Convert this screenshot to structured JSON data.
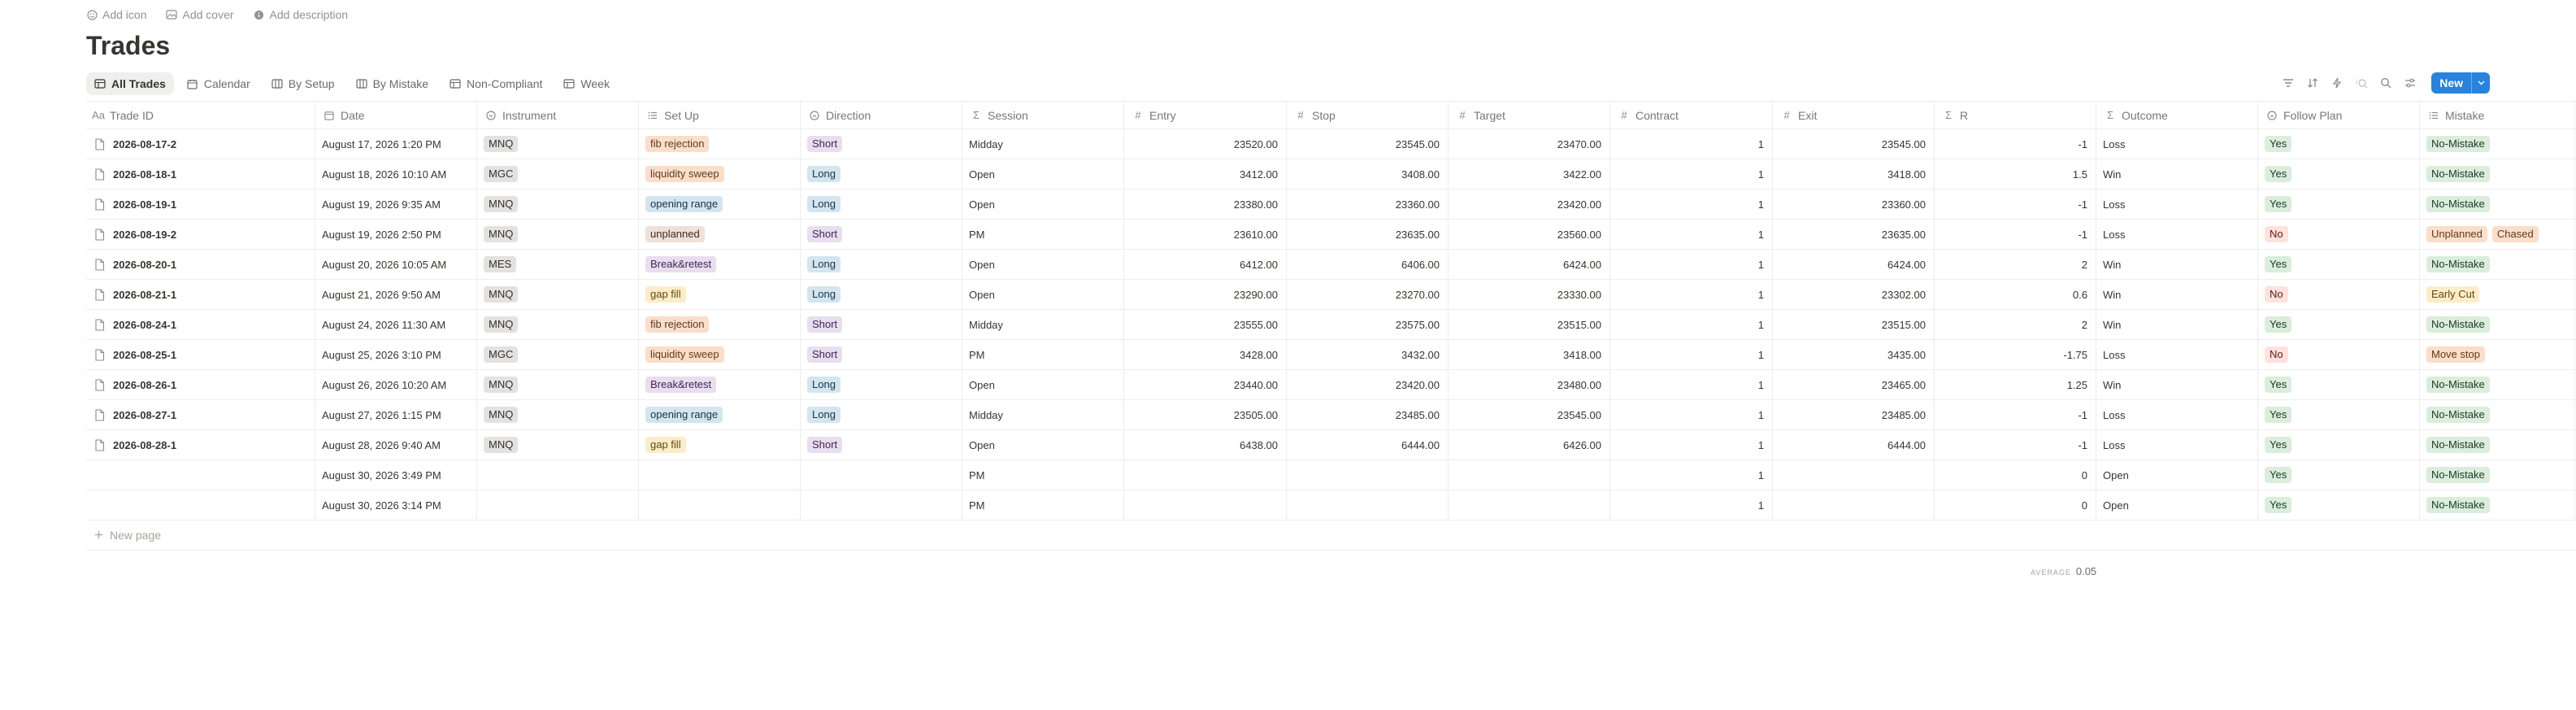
{
  "top_links": [
    {
      "label": "Add icon",
      "icon": "emoji-icon"
    },
    {
      "label": "Add cover",
      "icon": "image-icon"
    },
    {
      "label": "Add description",
      "icon": "info-icon"
    }
  ],
  "page_title": "Trades",
  "tabs": [
    {
      "label": "All Trades",
      "icon": "table-icon",
      "active": true
    },
    {
      "label": "Calendar",
      "icon": "calendar-icon"
    },
    {
      "label": "By Setup",
      "icon": "board-icon"
    },
    {
      "label": "By Mistake",
      "icon": "board-icon"
    },
    {
      "label": "Non-Compliant",
      "icon": "table-icon"
    },
    {
      "label": "Week",
      "icon": "table-icon"
    }
  ],
  "toolbar": {
    "new_label": "New",
    "accent": "#2783de"
  },
  "columns": [
    {
      "label": "Trade ID",
      "icon": "Aa"
    },
    {
      "label": "Date",
      "icon": "calendar"
    },
    {
      "label": "Instrument",
      "icon": "select"
    },
    {
      "label": "Set Up",
      "icon": "list"
    },
    {
      "label": "Direction",
      "icon": "select"
    },
    {
      "label": "Session",
      "icon": "Σ"
    },
    {
      "label": "Entry",
      "icon": "#"
    },
    {
      "label": "Stop",
      "icon": "#"
    },
    {
      "label": "Target",
      "icon": "#"
    },
    {
      "label": "Contract",
      "icon": "#"
    },
    {
      "label": "Exit",
      "icon": "#"
    },
    {
      "label": "R",
      "icon": "Σ"
    },
    {
      "label": "Outcome",
      "icon": "Σ"
    },
    {
      "label": "Follow Plan",
      "icon": "select"
    },
    {
      "label": "Mistake",
      "icon": "list"
    }
  ],
  "rows": [
    {
      "id": "2026-08-17-2",
      "date": "August 17, 2026 1:20 PM",
      "instrument": "MNQ",
      "setup": "fib rejection",
      "direction": "Short",
      "session": "Midday",
      "entry": "23520.00",
      "stop": "23545.00",
      "target": "23470.00",
      "contract": "1",
      "exit": "23545.00",
      "r": "-1",
      "outcome": "Loss",
      "follow": "Yes",
      "mistakes": [
        "No-Mistake"
      ]
    },
    {
      "id": "2026-08-18-1",
      "date": "August 18, 2026 10:10 AM",
      "instrument": "MGC",
      "setup": "liquidity sweep",
      "direction": "Long",
      "session": "Open",
      "entry": "3412.00",
      "stop": "3408.00",
      "target": "3422.00",
      "contract": "1",
      "exit": "3418.00",
      "r": "1.5",
      "outcome": "Win",
      "follow": "Yes",
      "mistakes": [
        "No-Mistake"
      ]
    },
    {
      "id": "2026-08-19-1",
      "date": "August 19, 2026 9:35 AM",
      "instrument": "MNQ",
      "setup": "opening range",
      "direction": "Long",
      "session": "Open",
      "entry": "23380.00",
      "stop": "23360.00",
      "target": "23420.00",
      "contract": "1",
      "exit": "23360.00",
      "r": "-1",
      "outcome": "Loss",
      "follow": "Yes",
      "mistakes": [
        "No-Mistake"
      ]
    },
    {
      "id": "2026-08-19-2",
      "date": "August 19, 2026 2:50 PM",
      "instrument": "MNQ",
      "setup": "unplanned",
      "direction": "Short",
      "session": "PM",
      "entry": "23610.00",
      "stop": "23635.00",
      "target": "23560.00",
      "contract": "1",
      "exit": "23635.00",
      "r": "-1",
      "outcome": "Loss",
      "follow": "No",
      "mistakes": [
        "Unplanned",
        "Chased"
      ]
    },
    {
      "id": "2026-08-20-1",
      "date": "August 20, 2026 10:05 AM",
      "instrument": "MES",
      "setup": "Break&retest",
      "direction": "Long",
      "session": "Open",
      "entry": "6412.00",
      "stop": "6406.00",
      "target": "6424.00",
      "contract": "1",
      "exit": "6424.00",
      "r": "2",
      "outcome": "Win",
      "follow": "Yes",
      "mistakes": [
        "No-Mistake"
      ]
    },
    {
      "id": "2026-08-21-1",
      "date": "August 21, 2026 9:50 AM",
      "instrument": "MNQ",
      "setup": "gap fill",
      "direction": "Long",
      "session": "Open",
      "entry": "23290.00",
      "stop": "23270.00",
      "target": "23330.00",
      "contract": "1",
      "exit": "23302.00",
      "r": "0.6",
      "outcome": "Win",
      "follow": "No",
      "mistakes": [
        "Early Cut"
      ]
    },
    {
      "id": "2026-08-24-1",
      "date": "August 24, 2026 11:30 AM",
      "instrument": "MNQ",
      "setup": "fib rejection",
      "direction": "Short",
      "session": "Midday",
      "entry": "23555.00",
      "stop": "23575.00",
      "target": "23515.00",
      "contract": "1",
      "exit": "23515.00",
      "r": "2",
      "outcome": "Win",
      "follow": "Yes",
      "mistakes": [
        "No-Mistake"
      ]
    },
    {
      "id": "2026-08-25-1",
      "date": "August 25, 2026 3:10 PM",
      "instrument": "MGC",
      "setup": "liquidity sweep",
      "direction": "Short",
      "session": "PM",
      "entry": "3428.00",
      "stop": "3432.00",
      "target": "3418.00",
      "contract": "1",
      "exit": "3435.00",
      "r": "-1.75",
      "outcome": "Loss",
      "follow": "No",
      "mistakes": [
        "Move stop"
      ]
    },
    {
      "id": "2026-08-26-1",
      "date": "August 26, 2026 10:20 AM",
      "instrument": "MNQ",
      "setup": "Break&retest",
      "direction": "Long",
      "session": "Open",
      "entry": "23440.00",
      "stop": "23420.00",
      "target": "23480.00",
      "contract": "1",
      "exit": "23465.00",
      "r": "1.25",
      "outcome": "Win",
      "follow": "Yes",
      "mistakes": [
        "No-Mistake"
      ]
    },
    {
      "id": "2026-08-27-1",
      "date": "August 27, 2026 1:15 PM",
      "instrument": "MNQ",
      "setup": "opening range",
      "direction": "Long",
      "session": "Midday",
      "entry": "23505.00",
      "stop": "23485.00",
      "target": "23545.00",
      "contract": "1",
      "exit": "23485.00",
      "r": "-1",
      "outcome": "Loss",
      "follow": "Yes",
      "mistakes": [
        "No-Mistake"
      ]
    },
    {
      "id": "2026-08-28-1",
      "date": "August 28, 2026 9:40 AM",
      "instrument": "MNQ",
      "setup": "gap fill",
      "direction": "Short",
      "session": "Open",
      "entry": "6438.00",
      "stop": "6444.00",
      "target": "6426.00",
      "contract": "1",
      "exit": "6444.00",
      "r": "-1",
      "outcome": "Loss",
      "follow": "Yes",
      "mistakes": [
        "No-Mistake"
      ]
    },
    {
      "id": "",
      "date": "August 30, 2026 3:49 PM",
      "instrument": "",
      "setup": "",
      "direction": "",
      "session": "PM",
      "entry": "",
      "stop": "",
      "target": "",
      "contract": "1",
      "exit": "",
      "r": "0",
      "outcome": "Open",
      "follow": "Yes",
      "mistakes": [
        "No-Mistake"
      ]
    },
    {
      "id": "",
      "date": "August 30, 2026 3:14 PM",
      "instrument": "",
      "setup": "",
      "direction": "",
      "session": "PM",
      "entry": "",
      "stop": "",
      "target": "",
      "contract": "1",
      "exit": "",
      "r": "0",
      "outcome": "Open",
      "follow": "Yes",
      "mistakes": [
        "No-Mistake"
      ]
    }
  ],
  "tag_colors": {
    "MNQ": "gray",
    "MGC": "gray",
    "MES": "gray",
    "fib rejection": "orange",
    "liquidity sweep": "orange",
    "opening range": "blue",
    "unplanned": "brown",
    "Break&retest": "purple",
    "gap fill": "yellow",
    "Short": "purple",
    "Long": "blue",
    "Yes": "green",
    "No": "red",
    "No-Mistake": "green",
    "Unplanned": "orange",
    "Chased": "orange",
    "Early Cut": "yellow",
    "Move stop": "orange"
  },
  "new_page_label": "New page",
  "summary": {
    "label": "AVERAGE",
    "value": "0.05"
  }
}
